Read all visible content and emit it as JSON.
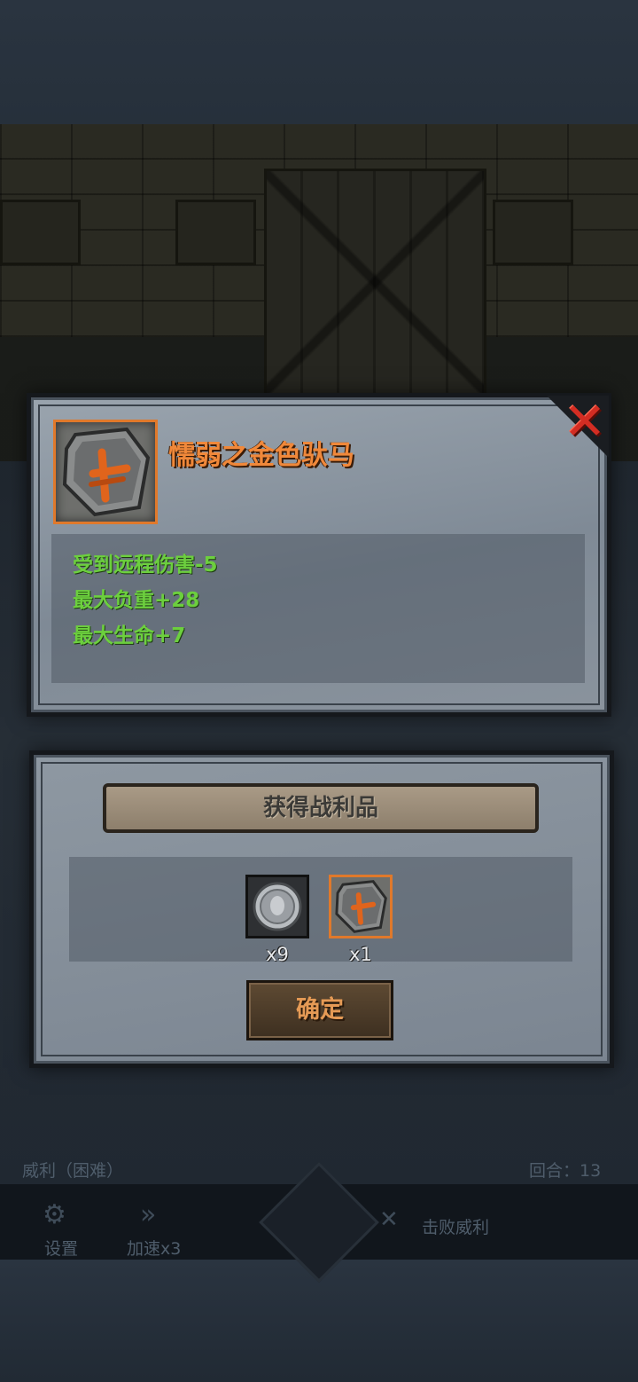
{
  "item": {
    "name": "懦弱之金色驮马",
    "icon": "rune-stone-icon",
    "stats": [
      "受到远程伤害-5",
      "最大负重+28",
      "最大生命+7"
    ]
  },
  "loot": {
    "title": "获得战利品",
    "items": [
      {
        "icon": "silver-coin-icon",
        "count": "x9"
      },
      {
        "icon": "rune-stone-icon",
        "count": "x1"
      }
    ],
    "confirm_label": "确定"
  },
  "hud": {
    "stage_label": "威利（困难）",
    "round_label": "回合：13",
    "settings_label": "设置",
    "speed_label": "加速x3",
    "objective_label": "击败威利"
  },
  "colors": {
    "item_name": "#f0883a",
    "stat_positive": "#6ccf3e",
    "rarity_border": "#e0792b",
    "close_red": "#d32d23"
  }
}
